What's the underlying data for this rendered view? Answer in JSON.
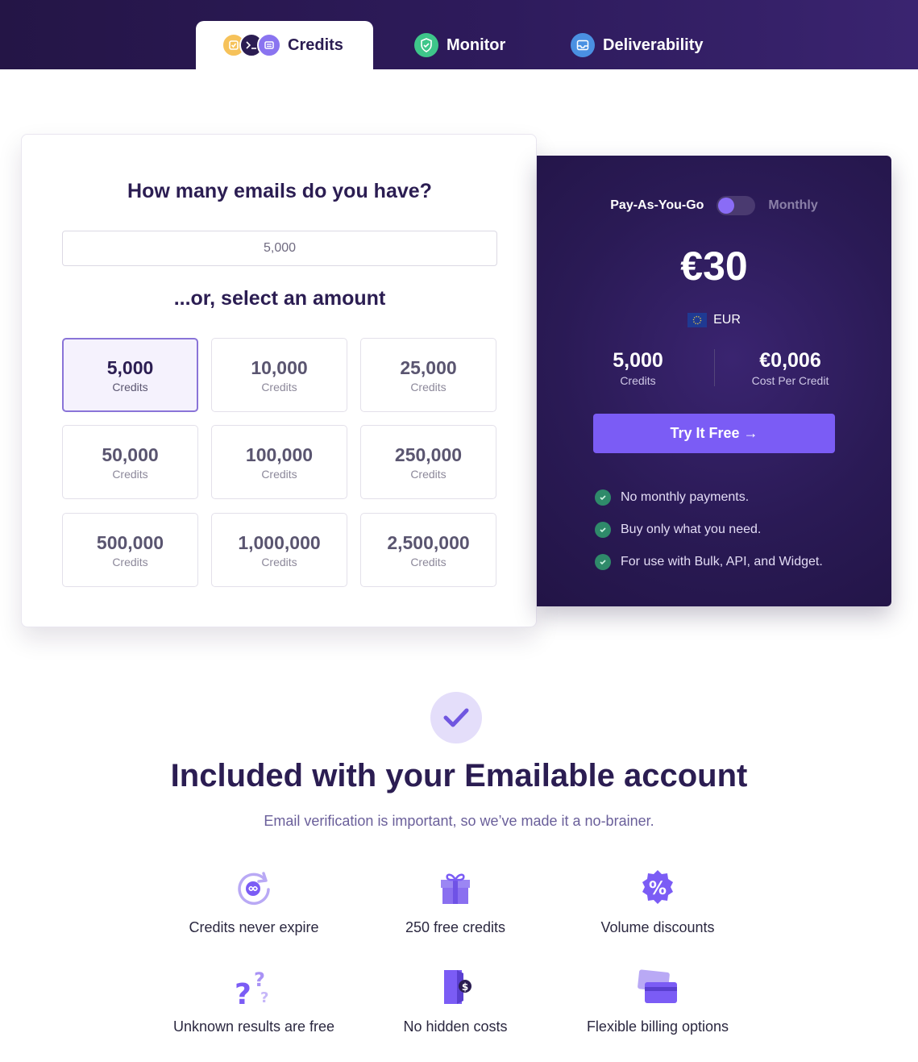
{
  "tabs": [
    {
      "label": "Credits",
      "active": true
    },
    {
      "label": "Monitor",
      "active": false
    },
    {
      "label": "Deliverability",
      "active": false
    }
  ],
  "calculator": {
    "title": "How many emails do you have?",
    "input_value": "5,000",
    "select_title": "...or, select an amount",
    "options": [
      {
        "value": "5,000",
        "label": "Credits",
        "selected": true
      },
      {
        "value": "10,000",
        "label": "Credits"
      },
      {
        "value": "25,000",
        "label": "Credits"
      },
      {
        "value": "50,000",
        "label": "Credits"
      },
      {
        "value": "100,000",
        "label": "Credits"
      },
      {
        "value": "250,000",
        "label": "Credits"
      },
      {
        "value": "500,000",
        "label": "Credits"
      },
      {
        "value": "1,000,000",
        "label": "Credits"
      },
      {
        "value": "2,500,000",
        "label": "Credits"
      }
    ]
  },
  "pricing": {
    "toggle_left": "Pay-As-You-Go",
    "toggle_right": "Monthly",
    "price": "€30",
    "currency": "EUR",
    "credits_value": "5,000",
    "credits_label": "Credits",
    "cost_value": "€0,006",
    "cost_label": "Cost Per Credit",
    "cta_label": "Try It Free →",
    "features": [
      "No monthly payments.",
      "Buy only what you need.",
      "For use with Bulk, API, and Widget."
    ]
  },
  "included": {
    "title": "Included with your Emailable account",
    "subtitle": "Email verification is important, so we’ve made it a no-brainer.",
    "benefits": [
      {
        "label": "Credits never expire",
        "icon": "infinity-refresh-icon"
      },
      {
        "label": "250 free credits",
        "icon": "gift-icon"
      },
      {
        "label": "Volume discounts",
        "icon": "percent-badge-icon"
      },
      {
        "label": "Unknown results are free",
        "icon": "question-marks-icon"
      },
      {
        "label": "No hidden costs",
        "icon": "door-dollar-icon"
      },
      {
        "label": "Flexible billing options",
        "icon": "credit-cards-icon"
      }
    ]
  },
  "colors": {
    "brand_dark": "#2b1d52",
    "accent": "#7b5cf5",
    "success": "#3ec68a"
  }
}
